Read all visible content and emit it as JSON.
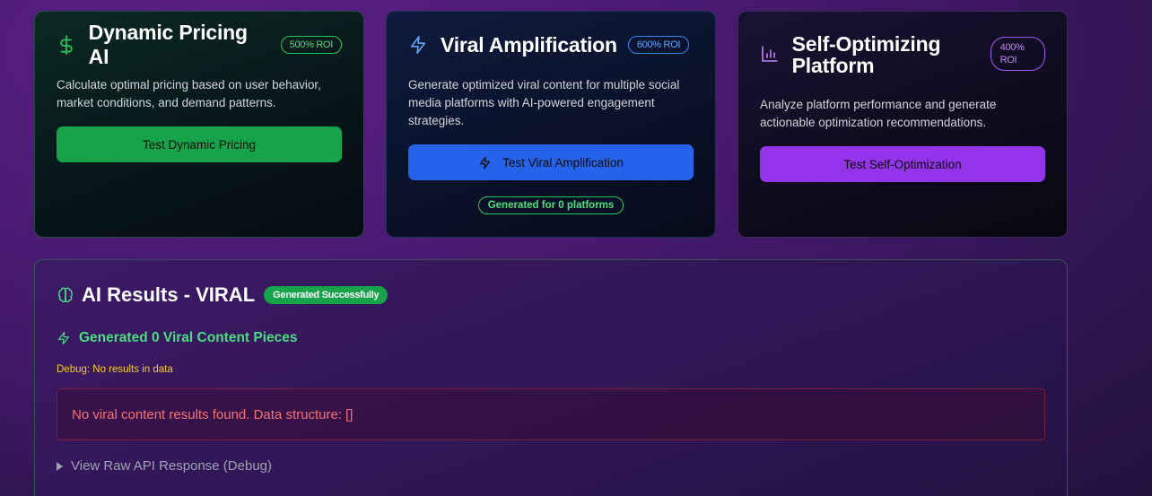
{
  "cards": {
    "pricing": {
      "icon": "dollar-icon",
      "title": "Dynamic Pricing AI",
      "roi": "500% ROI",
      "description": "Calculate optimal pricing based on user behavior, market conditions, and demand patterns.",
      "button": "Test Dynamic Pricing",
      "accent": "#16a34a"
    },
    "viral": {
      "icon": "lightning-icon",
      "title": "Viral Amplification",
      "roi": "600% ROI",
      "description": "Generate optimized viral content for multiple social media platforms with AI-powered engagement strategies.",
      "button": "Test Viral Amplification",
      "generated": "Generated for 0 platforms",
      "accent": "#2563eb"
    },
    "optimize": {
      "icon": "bar-chart-icon",
      "title": "Self-Optimizing Platform",
      "roi": "400% ROI",
      "description": "Analyze platform performance and generate actionable optimization recommendations.",
      "button": "Test Self-Optimization",
      "accent": "#9333ea"
    }
  },
  "results": {
    "icon": "brain-icon",
    "title": "AI Results - VIRAL",
    "status": "Generated Successfully",
    "generated_line": "Generated 0 Viral Content Pieces",
    "debug": "Debug: No results in data",
    "error": "No viral content results found. Data structure: []",
    "raw_toggle": "View Raw API Response (Debug)"
  }
}
